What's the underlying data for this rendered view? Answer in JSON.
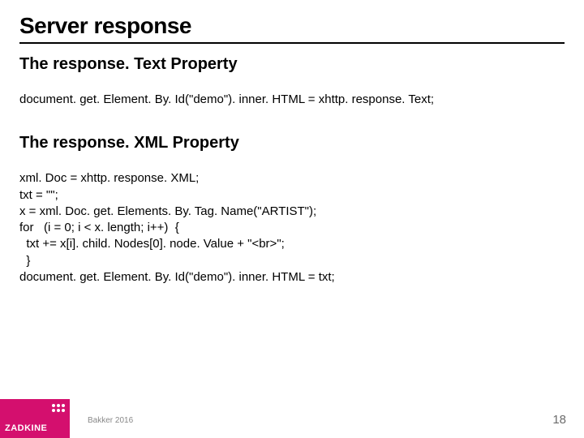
{
  "title": "Server response",
  "section1": {
    "heading": "The response. Text Property",
    "code": "document. get. Element. By. Id(\"demo\"). inner. HTML = xhttp. response. Text;"
  },
  "section2": {
    "heading": "The response. XML Property",
    "code_lines": [
      "xml. Doc = xhttp. response. XML;",
      "txt = \"\";",
      "x = xml. Doc. get. Elements. By. Tag. Name(\"ARTIST\");",
      "for   (i = 0; i < x. length; i++)  {",
      "  txt += x[i]. child. Nodes[0]. node. Value + \"<br>\";",
      "  }",
      "document. get. Element. By. Id(\"demo\"). inner. HTML = txt;"
    ]
  },
  "footer": {
    "logo": "ZADKINE",
    "author": "Bakker 2016",
    "page": "18"
  }
}
